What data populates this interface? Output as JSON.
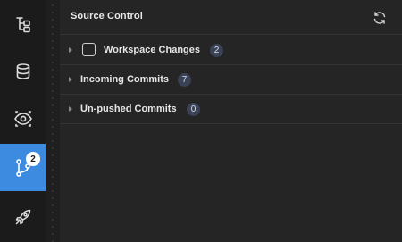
{
  "activity_bar": {
    "items": [
      {
        "icon": "file-tree-icon"
      },
      {
        "icon": "database-icon"
      },
      {
        "icon": "eye-icon"
      },
      {
        "icon": "source-control-icon",
        "badge": "2",
        "active": true
      },
      {
        "icon": "rocket-icon"
      }
    ]
  },
  "panel": {
    "title": "Source Control",
    "refresh_icon": "refresh-icon",
    "sections": [
      {
        "label": "Workspace Changes",
        "count": "2",
        "has_checkbox": true
      },
      {
        "label": "Incoming Commits",
        "count": "7"
      },
      {
        "label": "Un-pushed Commits",
        "count": "0"
      }
    ]
  },
  "colors": {
    "accent": "#3d8be0",
    "activity_bg": "#1b1b1b",
    "panel_bg": "#252525",
    "count_badge_bg": "#3a4256"
  }
}
